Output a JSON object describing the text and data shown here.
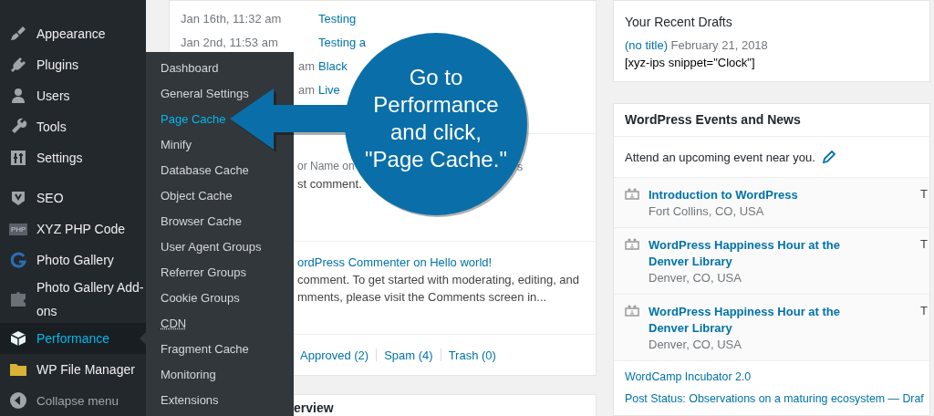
{
  "sidebar": {
    "items": [
      {
        "label": "Appearance",
        "selected": false
      },
      {
        "label": "Plugins",
        "selected": false
      },
      {
        "label": "Users",
        "selected": false
      },
      {
        "label": "Tools",
        "selected": false
      },
      {
        "label": "Settings",
        "selected": false
      },
      {
        "label": "SEO",
        "selected": false
      },
      {
        "label": "XYZ PHP Code",
        "selected": false,
        "badge": "PHP"
      },
      {
        "label": "Photo Gallery",
        "selected": false
      },
      {
        "label": "Photo Gallery Add-ons",
        "selected": false
      },
      {
        "label": "Performance",
        "selected": true
      },
      {
        "label": "WP File Manager",
        "selected": false
      }
    ],
    "collapse": "Collapse menu"
  },
  "submenu": {
    "items": [
      {
        "label": "Dashboard",
        "selected": false,
        "kind": "link"
      },
      {
        "label": "General Settings",
        "selected": false,
        "kind": "link"
      },
      {
        "label": "Page Cache",
        "selected": true,
        "kind": "link"
      },
      {
        "label": "Minify",
        "selected": false,
        "kind": "link"
      },
      {
        "label": "Database Cache",
        "selected": false,
        "kind": "link"
      },
      {
        "label": "Object Cache",
        "selected": false,
        "kind": "link"
      },
      {
        "label": "Browser Cache",
        "selected": false,
        "kind": "link"
      },
      {
        "label": "User Agent Groups",
        "selected": false,
        "kind": "link"
      },
      {
        "label": "Referrer Groups",
        "selected": false,
        "kind": "link"
      },
      {
        "label": "Cookie Groups",
        "selected": false,
        "kind": "link"
      },
      {
        "label": "CDN",
        "selected": false,
        "kind": "abbr"
      },
      {
        "label": "Fragment Cache",
        "selected": false,
        "kind": "link"
      },
      {
        "label": "Monitoring",
        "selected": false,
        "kind": "link"
      },
      {
        "label": "Extensions",
        "selected": false,
        "kind": "link"
      }
    ]
  },
  "callout": {
    "lines": [
      "Go to",
      "Performance",
      "and click,",
      "\"Page Cache.\""
    ]
  },
  "activity": {
    "rows": [
      {
        "date": "Jan 16th, 11:32 am",
        "title": "Testing"
      },
      {
        "date": "Jan 2nd, 11:53 am",
        "title": "Testing a"
      },
      {
        "date": "am",
        "title": "Black"
      },
      {
        "date": "am",
        "title": "Live"
      }
    ],
    "comments": [
      {
        "head": "or Name on",
        "head_tail": "s",
        "body": "st comment."
      },
      {
        "head": "ordPress Commenter on Hello world!",
        "body": "comment. To get started with moderating, editing, and mments, please visit the Comments screen in..."
      }
    ],
    "links": [
      "Approved (2)",
      "Spam (4)",
      "Trash (0)"
    ],
    "next_title": "erview"
  },
  "drafts": {
    "title": "Your Recent Drafts",
    "draft_title": "(no title)",
    "draft_date": "February 21, 2018",
    "excerpt": "[xyz-ips snippet=\"Clock\"]"
  },
  "events": {
    "title": "WordPress Events and News",
    "intro": "Attend an upcoming event near you.",
    "items": [
      {
        "title": "Introduction to WordPress",
        "location": "Fort Collins, CO, USA",
        "date": "T"
      },
      {
        "title": "WordPress Happiness Hour at the Denver Library",
        "location": "Denver, CO, USA",
        "date": "T"
      },
      {
        "title": "WordPress Happiness Hour at the Denver Library",
        "location": "Denver, CO, USA",
        "date": "T"
      }
    ],
    "news": [
      "WordCamp Incubator 2.0",
      "Post Status: Observations on a maturing ecosystem — Draf"
    ]
  }
}
